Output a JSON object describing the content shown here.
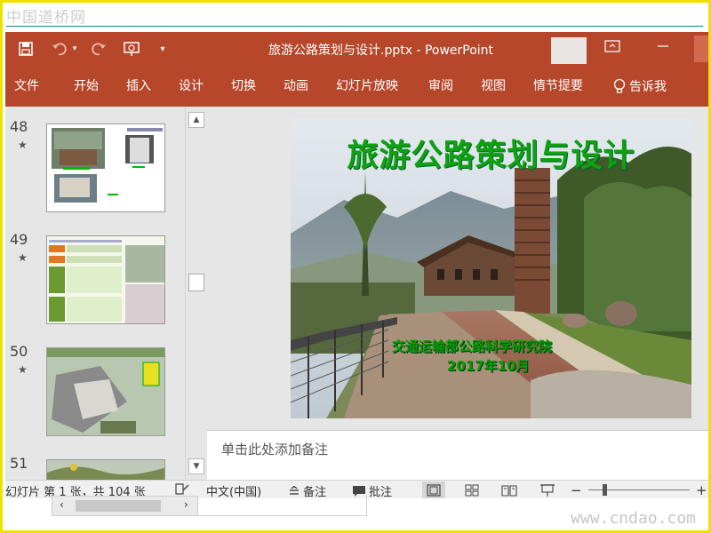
{
  "watermark": {
    "top": "中国道桥网",
    "bottom": "www.cndao.com"
  },
  "titlebar": {
    "title": "旅游公路策划与设计.pptx  -  PowerPoint",
    "qat": [
      "save-icon",
      "undo-icon",
      "redo-icon",
      "slideshow-from-start-icon",
      "customize-qat-icon"
    ]
  },
  "ribbon": {
    "tabs": [
      "文件",
      "开始",
      "插入",
      "设计",
      "切换",
      "动画",
      "幻灯片放映",
      "审阅",
      "视图",
      "情节提要"
    ],
    "tell_me": "告诉我"
  },
  "thumbnails": [
    {
      "number": "48",
      "star": "★"
    },
    {
      "number": "49",
      "star": "★"
    },
    {
      "number": "50",
      "star": "★"
    },
    {
      "number": "51"
    }
  ],
  "slide": {
    "title": "旅游公路策划与设计",
    "organization": "交通运输部公路科学研究院",
    "date": "2017年10月"
  },
  "notes": {
    "placeholder": "单击此处添加备注"
  },
  "statusbar": {
    "slide_info": "幻灯片 第 1 张，共 104 张",
    "language": "中文(中国)",
    "notes_label": "备注",
    "comments_label": "批注",
    "zoom_minus": "−",
    "zoom_plus": "+"
  },
  "colors": {
    "ribbon": "#b7472a",
    "title_green": "#0fa10f"
  }
}
